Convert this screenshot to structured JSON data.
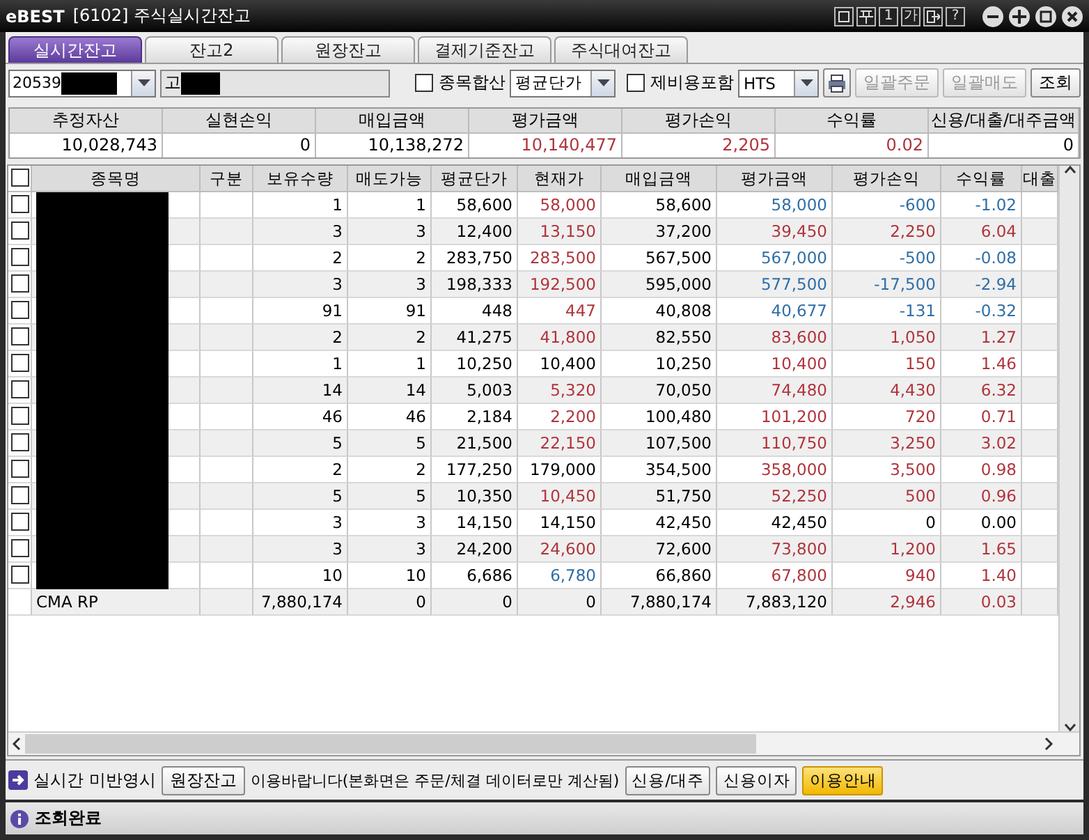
{
  "window": {
    "logo": "eBEST",
    "title": "[6102] 주식실시간잔고",
    "tools": [
      {
        "kind": "square"
      },
      {
        "kind": "pin"
      },
      {
        "kind": "text",
        "label": "1"
      },
      {
        "kind": "text",
        "label": "가"
      },
      {
        "kind": "exit"
      },
      {
        "kind": "text",
        "label": "?"
      }
    ]
  },
  "tabs": [
    {
      "label": "실시간잔고",
      "selected": true
    },
    {
      "label": "잔고2",
      "selected": false
    },
    {
      "label": "원장잔고",
      "selected": false
    },
    {
      "label": "결제기준잔고",
      "selected": false
    },
    {
      "label": "주식대여잔고",
      "selected": false
    }
  ],
  "toolbar": {
    "account": {
      "value": "20539"
    },
    "account_name": {
      "value": "고"
    },
    "merge": {
      "label": "종목합산",
      "checked": false
    },
    "price_basis": {
      "value": "평균단가"
    },
    "fees": {
      "label": "제비용포함",
      "checked": false
    },
    "channel": {
      "value": "HTS"
    },
    "buttons": [
      {
        "label": "일괄주문",
        "disabled": true
      },
      {
        "label": "일괄매도",
        "disabled": true
      },
      {
        "label": "조회",
        "disabled": false
      }
    ]
  },
  "summary": [
    {
      "label": "추정자산",
      "value": "10,028,743",
      "color": "#000000"
    },
    {
      "label": "실현손익",
      "value": "0",
      "color": "#000000"
    },
    {
      "label": "매입금액",
      "value": "10,138,272",
      "color": "#000000"
    },
    {
      "label": "평가금액",
      "value": "10,140,477",
      "color": "#b0343c"
    },
    {
      "label": "평가손익",
      "value": "2,205",
      "color": "#b0343c"
    },
    {
      "label": "수익률",
      "value": "0.02",
      "color": "#b0343c"
    },
    {
      "label": "신용/대출/대주금액",
      "value": "0",
      "color": "#000000"
    }
  ],
  "table": {
    "select_all": {
      "checked": false
    },
    "columns": [
      "종목명",
      "구분",
      "보유수량",
      "매도가능",
      "평균단가",
      "현재가",
      "매입금액",
      "평가금액",
      "평가손익",
      "수익률",
      "대출"
    ],
    "rows": [
      {
        "checked": false,
        "redacted": true,
        "qty": "1",
        "sellable": "1",
        "avg": "58,600",
        "price": {
          "text": "58,000",
          "color": "#b0343c"
        },
        "buy": "58,600",
        "eval": {
          "text": "58,000",
          "color": "#2f6ea6"
        },
        "pl": {
          "text": "-600",
          "color": "#2f6ea6"
        },
        "rate": {
          "text": "-1.02",
          "color": "#2f6ea6"
        }
      },
      {
        "checked": false,
        "redacted": true,
        "qty": "3",
        "sellable": "3",
        "avg": "12,400",
        "price": {
          "text": "13,150",
          "color": "#b0343c"
        },
        "buy": "37,200",
        "eval": {
          "text": "39,450",
          "color": "#b0343c"
        },
        "pl": {
          "text": "2,250",
          "color": "#b0343c"
        },
        "rate": {
          "text": "6.04",
          "color": "#b0343c"
        }
      },
      {
        "checked": false,
        "redacted": true,
        "qty": "2",
        "sellable": "2",
        "avg": "283,750",
        "price": {
          "text": "283,500",
          "color": "#b0343c"
        },
        "buy": "567,500",
        "eval": {
          "text": "567,000",
          "color": "#2f6ea6"
        },
        "pl": {
          "text": "-500",
          "color": "#2f6ea6"
        },
        "rate": {
          "text": "-0.08",
          "color": "#2f6ea6"
        }
      },
      {
        "checked": false,
        "redacted": true,
        "qty": "3",
        "sellable": "3",
        "avg": "198,333",
        "price": {
          "text": "192,500",
          "color": "#b0343c"
        },
        "buy": "595,000",
        "eval": {
          "text": "577,500",
          "color": "#2f6ea6"
        },
        "pl": {
          "text": "-17,500",
          "color": "#2f6ea6"
        },
        "rate": {
          "text": "-2.94",
          "color": "#2f6ea6"
        }
      },
      {
        "checked": false,
        "redacted": true,
        "qty": "91",
        "sellable": "91",
        "avg": "448",
        "price": {
          "text": "447",
          "color": "#b0343c"
        },
        "buy": "40,808",
        "eval": {
          "text": "40,677",
          "color": "#2f6ea6"
        },
        "pl": {
          "text": "-131",
          "color": "#2f6ea6"
        },
        "rate": {
          "text": "-0.32",
          "color": "#2f6ea6"
        }
      },
      {
        "checked": false,
        "redacted": true,
        "qty": "2",
        "sellable": "2",
        "avg": "41,275",
        "price": {
          "text": "41,800",
          "color": "#b0343c"
        },
        "buy": "82,550",
        "eval": {
          "text": "83,600",
          "color": "#b0343c"
        },
        "pl": {
          "text": "1,050",
          "color": "#b0343c"
        },
        "rate": {
          "text": "1.27",
          "color": "#b0343c"
        }
      },
      {
        "checked": false,
        "redacted": true,
        "qty": "1",
        "sellable": "1",
        "avg": "10,250",
        "price": {
          "text": "10,400",
          "color": "#000000"
        },
        "buy": "10,250",
        "eval": {
          "text": "10,400",
          "color": "#b0343c"
        },
        "pl": {
          "text": "150",
          "color": "#b0343c"
        },
        "rate": {
          "text": "1.46",
          "color": "#b0343c"
        }
      },
      {
        "checked": false,
        "redacted": true,
        "qty": "14",
        "sellable": "14",
        "avg": "5,003",
        "price": {
          "text": "5,320",
          "color": "#b0343c"
        },
        "buy": "70,050",
        "eval": {
          "text": "74,480",
          "color": "#b0343c"
        },
        "pl": {
          "text": "4,430",
          "color": "#b0343c"
        },
        "rate": {
          "text": "6.32",
          "color": "#b0343c"
        }
      },
      {
        "checked": false,
        "redacted": true,
        "qty": "46",
        "sellable": "46",
        "avg": "2,184",
        "price": {
          "text": "2,200",
          "color": "#b0343c"
        },
        "buy": "100,480",
        "eval": {
          "text": "101,200",
          "color": "#b0343c"
        },
        "pl": {
          "text": "720",
          "color": "#b0343c"
        },
        "rate": {
          "text": "0.71",
          "color": "#b0343c"
        }
      },
      {
        "checked": false,
        "redacted": true,
        "qty": "5",
        "sellable": "5",
        "avg": "21,500",
        "price": {
          "text": "22,150",
          "color": "#b0343c"
        },
        "buy": "107,500",
        "eval": {
          "text": "110,750",
          "color": "#b0343c"
        },
        "pl": {
          "text": "3,250",
          "color": "#b0343c"
        },
        "rate": {
          "text": "3.02",
          "color": "#b0343c"
        }
      },
      {
        "checked": false,
        "redacted": true,
        "qty": "2",
        "sellable": "2",
        "avg": "177,250",
        "price": {
          "text": "179,000",
          "color": "#000000"
        },
        "buy": "354,500",
        "eval": {
          "text": "358,000",
          "color": "#b0343c"
        },
        "pl": {
          "text": "3,500",
          "color": "#b0343c"
        },
        "rate": {
          "text": "0.98",
          "color": "#b0343c"
        }
      },
      {
        "checked": false,
        "redacted": true,
        "qty": "5",
        "sellable": "5",
        "avg": "10,350",
        "price": {
          "text": "10,450",
          "color": "#b0343c"
        },
        "buy": "51,750",
        "eval": {
          "text": "52,250",
          "color": "#b0343c"
        },
        "pl": {
          "text": "500",
          "color": "#b0343c"
        },
        "rate": {
          "text": "0.96",
          "color": "#b0343c"
        }
      },
      {
        "checked": false,
        "redacted": true,
        "qty": "3",
        "sellable": "3",
        "avg": "14,150",
        "price": {
          "text": "14,150",
          "color": "#000000"
        },
        "buy": "42,450",
        "eval": {
          "text": "42,450",
          "color": "#000000"
        },
        "pl": {
          "text": "0",
          "color": "#000000"
        },
        "rate": {
          "text": "0.00",
          "color": "#000000"
        }
      },
      {
        "checked": false,
        "redacted": true,
        "qty": "3",
        "sellable": "3",
        "avg": "24,200",
        "price": {
          "text": "24,600",
          "color": "#b0343c"
        },
        "buy": "72,600",
        "eval": {
          "text": "73,800",
          "color": "#b0343c"
        },
        "pl": {
          "text": "1,200",
          "color": "#b0343c"
        },
        "rate": {
          "text": "1.65",
          "color": "#b0343c"
        }
      },
      {
        "checked": false,
        "redacted": true,
        "qty": "10",
        "sellable": "10",
        "avg": "6,686",
        "price": {
          "text": "6,780",
          "color": "#2f6ea6"
        },
        "buy": "66,860",
        "eval": {
          "text": "67,800",
          "color": "#b0343c"
        },
        "pl": {
          "text": "940",
          "color": "#b0343c"
        },
        "rate": {
          "text": "1.40",
          "color": "#b0343c"
        }
      },
      {
        "kind": "total",
        "name": "CMA RP",
        "qty": "7,880,174",
        "sellable": "0",
        "avg": "0",
        "price": {
          "text": "0",
          "color": "#000000"
        },
        "buy": "7,880,174",
        "eval": {
          "text": "7,883,120",
          "color": "#000000"
        },
        "pl": {
          "text": "2,946",
          "color": "#b0343c"
        },
        "rate": {
          "text": "0.03",
          "color": "#b0343c"
        }
      }
    ]
  },
  "footer": {
    "notice": "실시간 미반영시",
    "link_button": "원장잔고",
    "message": "이용바랍니다(본화면은 주문/체결 데이터로만 계산됨)",
    "buttons": [
      {
        "label": "신용/대주",
        "highlight": false
      },
      {
        "label": "신용이자",
        "highlight": false
      },
      {
        "label": "이용안내",
        "highlight": true
      }
    ]
  },
  "status_bar": {
    "text": "조회완료"
  }
}
